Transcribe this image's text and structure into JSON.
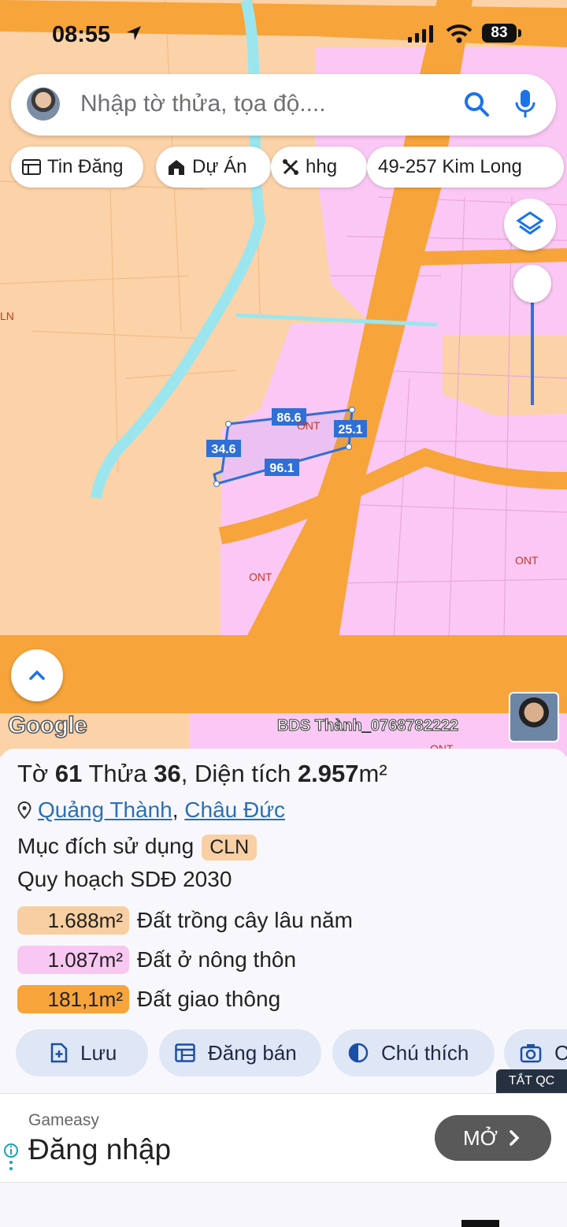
{
  "status_bar": {
    "time": "08:55",
    "battery": "83"
  },
  "search": {
    "placeholder": "Nhập tờ thửa, tọa độ...."
  },
  "chips": [
    "Tin Đăng",
    "Dự Án",
    "hhg",
    "49-257 Kim Long"
  ],
  "map": {
    "zone_labels": [
      "ONT",
      "ONT",
      "ONT",
      "LN",
      "ONT"
    ],
    "parcel_dimensions": [
      "86.6",
      "25.1",
      "34.6",
      "96.1"
    ],
    "google_logo": "Google",
    "watermark": "BDS Thành_0768782222",
    "colors": {
      "cln": "#fcd2a8",
      "ont": "#fbc8f5",
      "road": "#f7a43a",
      "water": "#9be6ee",
      "parcel": "#2f6fd6"
    }
  },
  "parcel": {
    "prefix_to": "Tờ",
    "sheet_no": "61",
    "label_thua": "Thửa",
    "plot_no": "36",
    "label_area": "Diện tích",
    "area": "2.957",
    "area_unit": "m²",
    "ward": "Quảng Thành",
    "district": "Châu Đức",
    "purpose_label": "Mục đích sử dụng",
    "purpose_code": "CLN",
    "plan_label": "Quy hoạch SDĐ 2030",
    "zones": [
      {
        "area": "1.688m²",
        "label": "Đất trồng cây lâu năm",
        "color": "#f8cfa2"
      },
      {
        "area": "1.087m²",
        "label": "Đất ở nông thôn",
        "color": "#f9c8f2"
      },
      {
        "area": "181,1m²",
        "label": "Đất giao thông",
        "color": "#f7a43a"
      }
    ]
  },
  "actions": [
    "Lưu",
    "Đăng bán",
    "Chú thích",
    "C"
  ],
  "ad": {
    "close_label": "TẮT QC",
    "brand": "Gameasy",
    "headline": "Đăng nhập",
    "cta": "MỞ"
  }
}
